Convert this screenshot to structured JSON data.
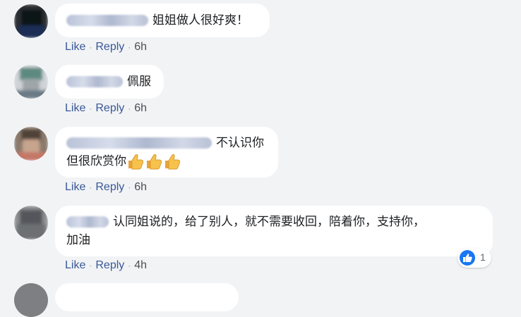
{
  "comments": [
    {
      "text": "姐姐做人很好爽！",
      "actions": {
        "like": "Like",
        "reply": "Reply",
        "time": "6h"
      }
    },
    {
      "text": "佩服",
      "actions": {
        "like": "Like",
        "reply": "Reply",
        "time": "6h"
      }
    },
    {
      "text_line1": "不认识你",
      "text_line2": "但很欣赏你",
      "emoji": "thumbs-up-emoji",
      "emoji_count": 3,
      "actions": {
        "like": "Like",
        "reply": "Reply",
        "time": "6h"
      }
    },
    {
      "text_line1": "认同姐说的，给了别人，就不需要收回，陪着你，支持你，",
      "text_line2": "加油",
      "actions": {
        "like": "Like",
        "reply": "Reply",
        "time": "4h"
      },
      "reaction": {
        "icon": "like-icon",
        "count": "1"
      }
    }
  ],
  "colors": {
    "background": "#f2f3f5",
    "link": "#385898",
    "like_blue": "#1877f2"
  }
}
